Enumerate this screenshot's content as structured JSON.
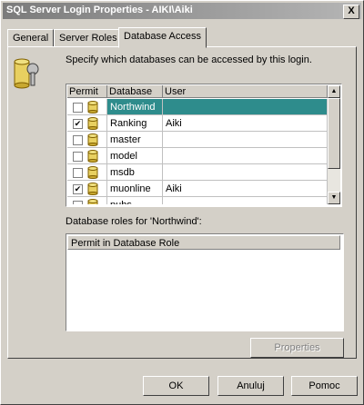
{
  "window": {
    "title": "SQL Server Login Properties - AIKI\\Aiki",
    "close_glyph": "X"
  },
  "tabs": [
    {
      "label": "General"
    },
    {
      "label": "Server Roles"
    },
    {
      "label": "Database Access"
    }
  ],
  "description": "Specify which databases can be accessed by this login.",
  "grid": {
    "columns": [
      "Permit",
      "Database",
      "User"
    ],
    "rows": [
      {
        "permit": false,
        "database": "Northwind",
        "user": ""
      },
      {
        "permit": true,
        "database": "Ranking",
        "user": "Aiki"
      },
      {
        "permit": false,
        "database": "master",
        "user": ""
      },
      {
        "permit": false,
        "database": "model",
        "user": ""
      },
      {
        "permit": false,
        "database": "msdb",
        "user": ""
      },
      {
        "permit": true,
        "database": "muonline",
        "user": "Aiki"
      },
      {
        "permit": false,
        "database": "pubs",
        "user": ""
      }
    ],
    "selected_index": 0
  },
  "roles": {
    "label": "Database roles for 'Northwind':",
    "header": "Permit in Database Role"
  },
  "buttons": {
    "properties": "Properties",
    "ok": "OK",
    "cancel": "Anuluj",
    "help": "Pomoc"
  },
  "colors": {
    "selection": "#2e8c8c",
    "face": "#d4d0c8",
    "title_gradient_start": "#7b7b7b"
  },
  "icons": {
    "check": "✔",
    "up": "▲",
    "down": "▼"
  }
}
